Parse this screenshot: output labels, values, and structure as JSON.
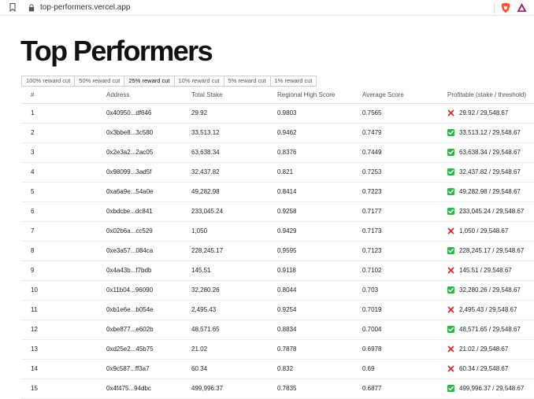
{
  "browser": {
    "url": "top-performers.vercel.app"
  },
  "page": {
    "title": "Top Performers"
  },
  "tabs": [
    {
      "label": "100% reward cut",
      "active": false
    },
    {
      "label": "50% reward cut",
      "active": false
    },
    {
      "label": "25% reward cut",
      "active": true
    },
    {
      "label": "10% reward cut",
      "active": false
    },
    {
      "label": "5% reward cut",
      "active": false
    },
    {
      "label": "1% reward cut",
      "active": false
    }
  ],
  "table": {
    "headers": [
      "#",
      "Address",
      "Total Stake",
      "Regional High Score",
      "Average Score",
      "Profitable (stake / threshold)"
    ],
    "rows": [
      {
        "rank": "1",
        "address": "0x40950...df646",
        "stake": "29.92",
        "high": "0.9803",
        "avg": "0.7565",
        "profitable": false,
        "ratio": "29.92 / 29,548.67"
      },
      {
        "rank": "2",
        "address": "0x3bbe8...3c580",
        "stake": "33,513.12",
        "high": "0.9462",
        "avg": "0.7479",
        "profitable": true,
        "ratio": "33,513.12 / 29,548.67"
      },
      {
        "rank": "3",
        "address": "0x2e3a2...2ac05",
        "stake": "63,638.34",
        "high": "0.8376",
        "avg": "0.7449",
        "profitable": true,
        "ratio": "63,638.34 / 29,548.67"
      },
      {
        "rank": "4",
        "address": "0x98099...3ad5f",
        "stake": "32,437.82",
        "high": "0.821",
        "avg": "0.7253",
        "profitable": true,
        "ratio": "32,437.82 / 29,548.67"
      },
      {
        "rank": "5",
        "address": "0xa6a9e...54a0e",
        "stake": "49,282.98",
        "high": "0.8414",
        "avg": "0.7223",
        "profitable": true,
        "ratio": "49,282.98 / 29,548.67"
      },
      {
        "rank": "6",
        "address": "0xbdcbe...dc841",
        "stake": "233,045.24",
        "high": "0.9258",
        "avg": "0.7177",
        "profitable": true,
        "ratio": "233,045.24 / 29,548.67"
      },
      {
        "rank": "7",
        "address": "0x02b6a...cc529",
        "stake": "1,050",
        "high": "0.9429",
        "avg": "0.7173",
        "profitable": false,
        "ratio": "1,050 / 29,548.67"
      },
      {
        "rank": "8",
        "address": "0xe3a57...084ca",
        "stake": "228,245.17",
        "high": "0.9595",
        "avg": "0.7123",
        "profitable": true,
        "ratio": "228,245.17 / 29,548.67"
      },
      {
        "rank": "9",
        "address": "0x4a43b...f7bdb",
        "stake": "145.51",
        "high": "0.9118",
        "avg": "0.7102",
        "profitable": false,
        "ratio": "145.51 / 29,548.67"
      },
      {
        "rank": "10",
        "address": "0x11b04...96090",
        "stake": "32,280.26",
        "high": "0.8044",
        "avg": "0.703",
        "profitable": true,
        "ratio": "32,280.26 / 29,548.67"
      },
      {
        "rank": "11",
        "address": "0xb1e6e...b054e",
        "stake": "2,495.43",
        "high": "0.9254",
        "avg": "0.7019",
        "profitable": false,
        "ratio": "2,495.43 / 29,548.67"
      },
      {
        "rank": "12",
        "address": "0xbe877...e602b",
        "stake": "48,571.65",
        "high": "0.8834",
        "avg": "0.7004",
        "profitable": true,
        "ratio": "48,571.65 / 29,548.67"
      },
      {
        "rank": "13",
        "address": "0xd25e2...45b75",
        "stake": "21.02",
        "high": "0.7878",
        "avg": "0.6978",
        "profitable": false,
        "ratio": "21.02 / 29,548.67"
      },
      {
        "rank": "14",
        "address": "0x9c587...ff3a7",
        "stake": "60.34",
        "high": "0.832",
        "avg": "0.69",
        "profitable": false,
        "ratio": "60.34 / 29,548.67"
      },
      {
        "rank": "15",
        "address": "0x4f475...94dbc",
        "stake": "499,996.37",
        "high": "0.7835",
        "avg": "0.6877",
        "profitable": true,
        "ratio": "499,996.37 / 29,548.67"
      }
    ]
  },
  "icons": {
    "profitable": "check-icon",
    "not_profitable": "cross-icon"
  },
  "colors": {
    "check": "#2eb44a",
    "cross": "#e0262b",
    "brave": "#fb542b",
    "rewards": "#9e1f63"
  }
}
